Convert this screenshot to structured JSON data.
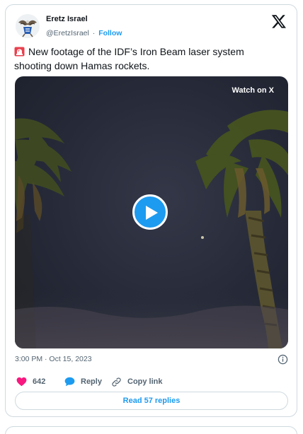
{
  "tweet": {
    "author_name": "Eretz Israel",
    "handle": "@EretzIsrael",
    "separator": "·",
    "follow_label": "Follow",
    "text": "New footage of the IDF’s Iron Beam laser system shooting down Hamas rockets.",
    "leading_emoji_icon": "rotating-light-siren-icon",
    "timestamp": "3:00 PM · Oct 15, 2023",
    "media": {
      "overlay_label": "Watch on X",
      "play_icon": "play-icon"
    },
    "actions": {
      "likes_count": "642",
      "reply_label": "Reply",
      "copy_link_label": "Copy link"
    },
    "read_replies_label": "Read 57 replies"
  },
  "colors": {
    "accent": "#1d9bf0",
    "like": "#f91880",
    "text_primary": "#0f1419",
    "text_secondary": "#536471",
    "border": "#cfd9de"
  }
}
